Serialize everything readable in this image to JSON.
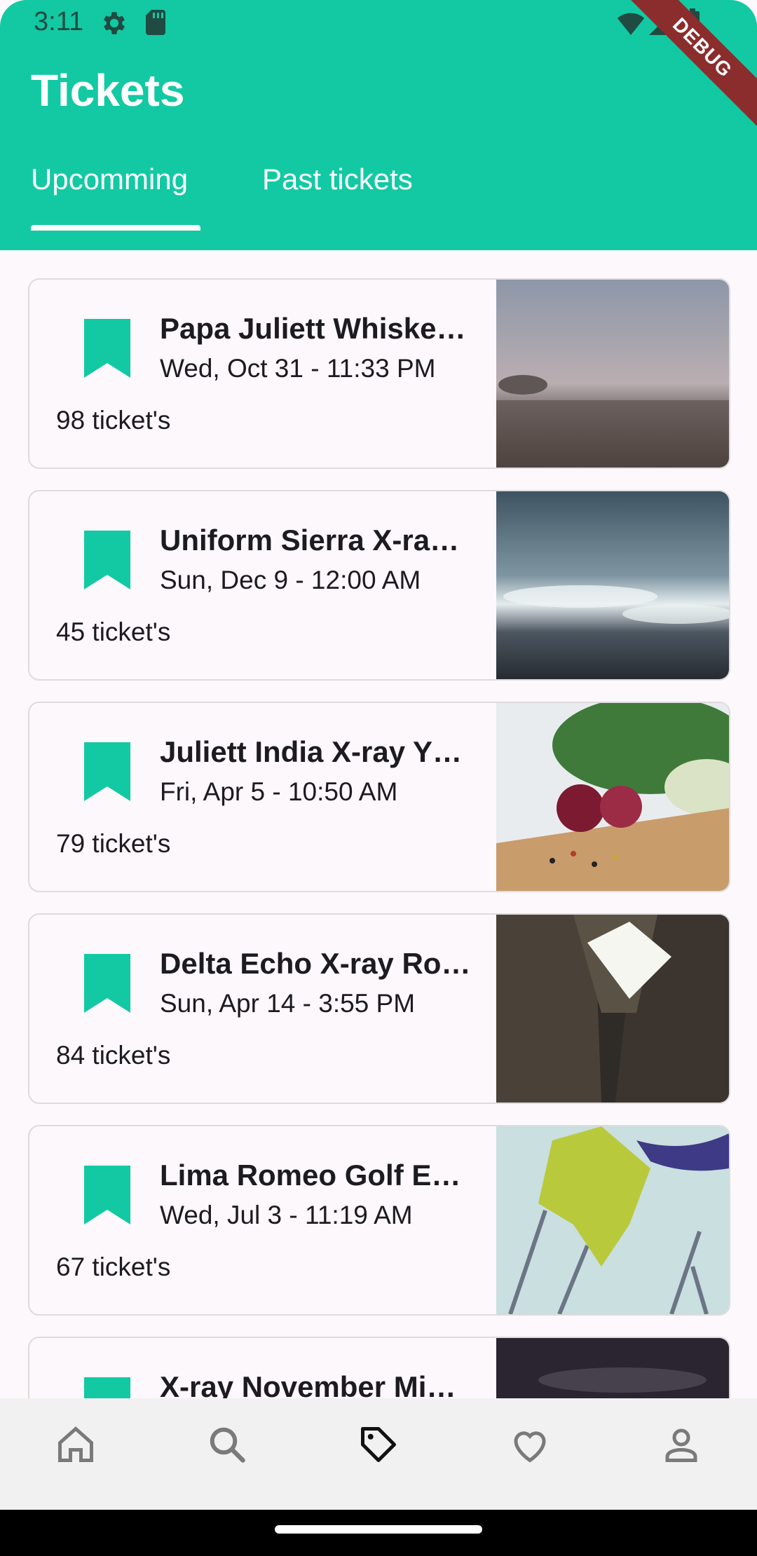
{
  "status_bar": {
    "time": "3:11",
    "debug_label": "DEBUG"
  },
  "header": {
    "title": "Tickets",
    "tabs": [
      {
        "label": "Upcomming",
        "selected": true
      },
      {
        "label": "Past tickets",
        "selected": false
      }
    ]
  },
  "tickets": [
    {
      "name": "Papa Juliett Whiske…",
      "date": "Wed, Oct 31 - 11:33 PM",
      "count": "98 ticket's",
      "image": "misty-field"
    },
    {
      "name": "Uniform Sierra X-ra…",
      "date": "Sun, Dec 9 - 12:00 AM",
      "count": "45 ticket's",
      "image": "ocean-waves"
    },
    {
      "name": "Juliett India X-ray Y…",
      "date": "Fri, Apr 5 - 10:50 AM",
      "count": "79 ticket's",
      "image": "onion-peppercorns"
    },
    {
      "name": "Delta Echo X-ray Ro…",
      "date": "Sun, Apr 14 - 3:55 PM",
      "count": "84 ticket's",
      "image": "building-courtyard"
    },
    {
      "name": "Lima Romeo Golf E…",
      "date": "Wed, Jul 3 - 11:19 AM",
      "count": "67 ticket's",
      "image": "yellow-leaf"
    },
    {
      "name": "X-ray November Mi…",
      "date": "",
      "count": "",
      "image": "dark-sky"
    }
  ],
  "bottom_nav": {
    "items": [
      {
        "icon": "home-icon"
      },
      {
        "icon": "search-icon"
      },
      {
        "icon": "tag-icon",
        "selected": true
      },
      {
        "icon": "heart-icon"
      },
      {
        "icon": "person-icon"
      }
    ]
  },
  "colors": {
    "accent": "#12c9a3",
    "background": "#fdf8fc",
    "debug_banner": "#8b2d2d"
  }
}
